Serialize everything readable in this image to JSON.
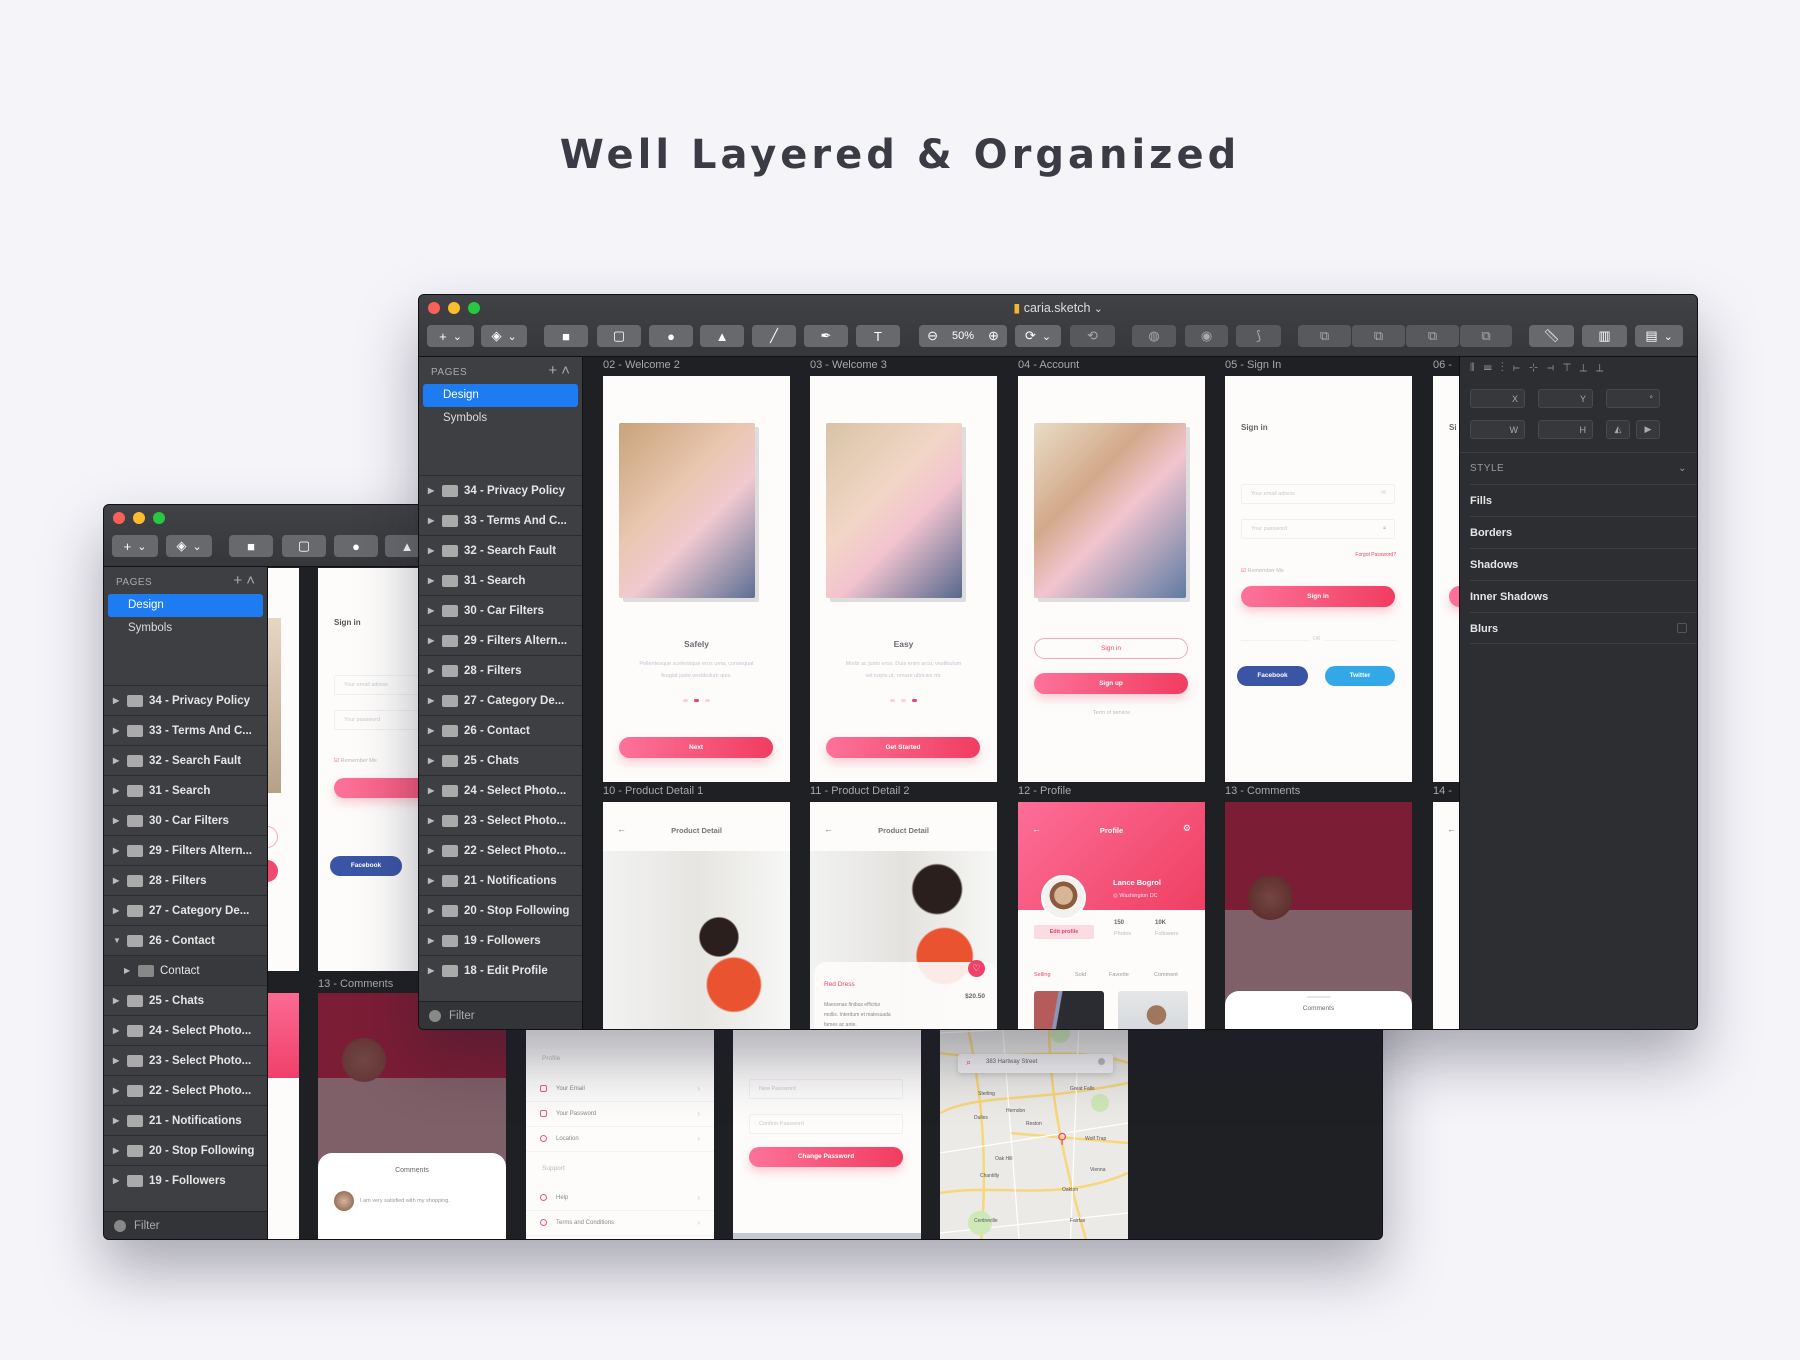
{
  "headline": "Well Layered & Organized",
  "front": {
    "filename": "caria.sketch",
    "zoom": "50%",
    "pages_header": "PAGES",
    "pages": [
      "Design",
      "Symbols"
    ],
    "selected_page": "Design",
    "layers": [
      "34 - Privacy Policy",
      "33 - Terms And C...",
      "32 - Search Fault",
      "31 - Search",
      "30 - Car Filters",
      "29 - Filters Altern...",
      "28 - Filters",
      "27 - Category De...",
      "26 - Contact",
      "25 - Chats",
      "24 - Select Photo...",
      "23 - Select Photo...",
      "22 - Select Photo...",
      "21 - Notifications",
      "20 - Stop Following",
      "19 - Followers",
      "18 - Edit Profile"
    ],
    "filter": "Filter",
    "inspector": {
      "x": "X",
      "y": "Y",
      "rot": "°",
      "w": "W",
      "h": "H",
      "style": "STYLE",
      "sections": [
        "Fills",
        "Borders",
        "Shadows",
        "Inner Shadows",
        "Blurs"
      ]
    },
    "row1": {
      "labels": [
        "02 - Welcome 2",
        "03 - Welcome 3",
        "04 - Account",
        "05 - Sign In",
        "06 -"
      ],
      "welcome2": {
        "title": "Safely",
        "desc1": "Pellentesque scelerisque eros urna, consequat",
        "desc2": "feugiat justo vestibulum quis.",
        "button": "Next"
      },
      "welcome3": {
        "title": "Easy",
        "desc1": "Morbi ac justo eros. Duis enim arcu, vestibulum",
        "desc2": "vel turpis ut, ornare ultricies mi.",
        "button": "Get Started"
      },
      "account": {
        "signin": "Sign in",
        "signup": "Sign up",
        "terms": "Term of service"
      },
      "signin": {
        "title": "Sign in",
        "email": "Your email adress",
        "password": "Your password",
        "forgot": "Forgot Password?",
        "remember": "Remember Me",
        "button": "Sign in",
        "or": "OR",
        "facebook": "Facebook",
        "twitter": "Twitter"
      },
      "partial": "Si"
    },
    "row2": {
      "labels": [
        "10 - Product Detail 1",
        "11 - Product Detail 2",
        "12 - Profile",
        "13 - Comments",
        "14 -"
      ],
      "product_title": "Product Detail",
      "product": {
        "name": "Red Dress",
        "price": "$20.50",
        "desc1": "Maecenas finibus efficitur",
        "desc2": "mollis. Interdum et malesuada",
        "desc3": "fames ac ante."
      },
      "profile": {
        "title": "Profile",
        "name": "Lance Bogrol",
        "location": "Washington DC",
        "edit": "Edit profile",
        "photos_count": "150",
        "photos_label": "Photos",
        "followers_count": "10K",
        "followers_label": "Followers",
        "tabs": [
          "Selling",
          "Sold",
          "Favorite",
          "Comment"
        ]
      },
      "comments": {
        "title": "Comments"
      }
    }
  },
  "back": {
    "pages_header": "PAGES",
    "pages": [
      "Design",
      "Symbols"
    ],
    "layers": [
      "34 - Privacy Policy",
      "33 - Terms And C...",
      "32 - Search Fault",
      "31 - Search",
      "30 - Car Filters",
      "29 - Filters Altern...",
      "28 - Filters",
      "27 - Category De...",
      "26 - Contact"
    ],
    "child": "Contact",
    "layers2": [
      "25 - Chats",
      "24 - Select Photo...",
      "23 - Select Photo...",
      "22 - Select Photo...",
      "21 - Notifications",
      "20 - Stop Following",
      "19 - Followers"
    ],
    "filter": "Filter",
    "signin": {
      "title": "Sign in",
      "email": "Your email adress",
      "password": "Your password",
      "remember": "Remember Me",
      "button": "Sign",
      "or": "OR",
      "facebook": "Facebook"
    },
    "comments_label": "13 - Comments",
    "comments": {
      "title": "Comments",
      "text": "I am very satisfied with my shopping."
    },
    "settings": {
      "profile": "Profile",
      "rows": [
        "Your Email",
        "Your Password",
        "Location"
      ],
      "support": "Support",
      "rows2": [
        "Help",
        "Terms and Conditions"
      ]
    },
    "password": {
      "new": "New Password",
      "confirm": "Confirm Password",
      "button": "Change Password"
    },
    "map": {
      "search": "383 Hartway Street",
      "places": [
        "Sterling",
        "Great Falls",
        "Herndon",
        "Dulles",
        "Reston",
        "Wolf Trap",
        "Oak Hill",
        "Chantilly",
        "Vienna",
        "Oakton",
        "Fairfax",
        "Centreville"
      ]
    }
  },
  "colors": {
    "accent": "#f0416a",
    "selection": "#1d7cf2",
    "facebook": "#3b55a6",
    "twitter": "#33a8e8"
  }
}
